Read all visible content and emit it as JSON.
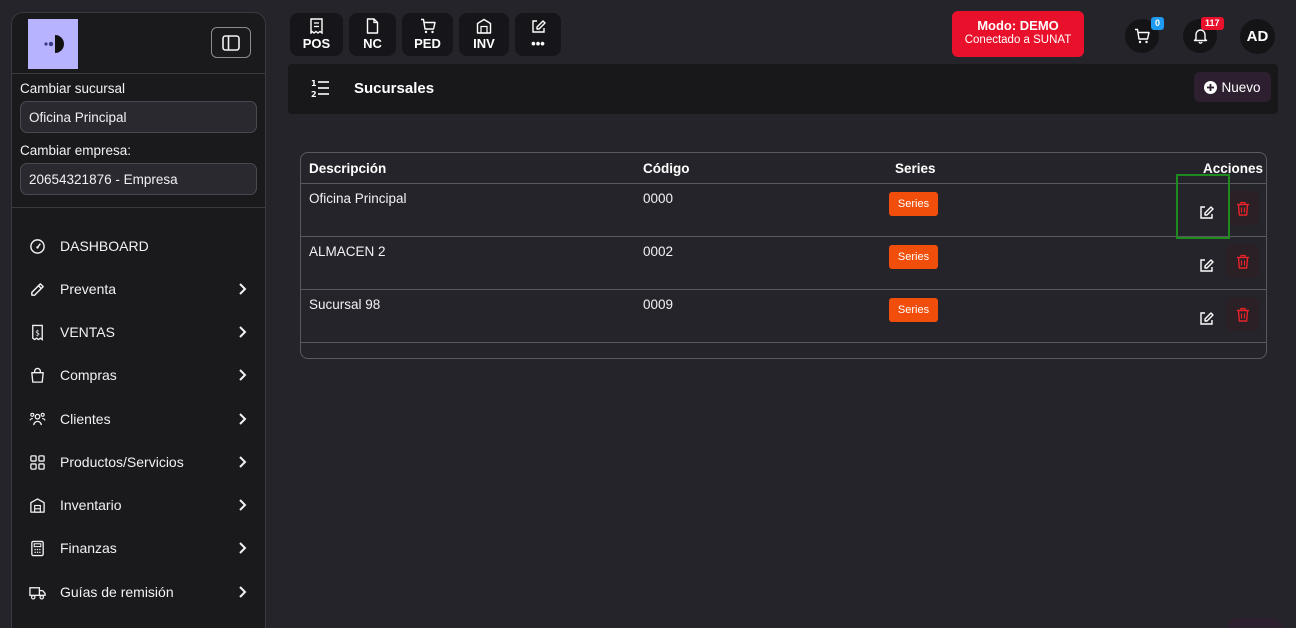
{
  "sidebar": {
    "branch_label": "Cambiar sucursal",
    "branch_value": "Oficina Principal",
    "company_label": "Cambiar empresa:",
    "company_value": "20654321876 - Empresa",
    "items": [
      {
        "label": "DASHBOARD",
        "icon": "gauge-icon"
      },
      {
        "label": "Preventa",
        "icon": "pencil-icon"
      },
      {
        "label": "VENTAS",
        "icon": "receipt-icon"
      },
      {
        "label": "Compras",
        "icon": "shopping-bag-icon"
      },
      {
        "label": "Clientes",
        "icon": "users-icon"
      },
      {
        "label": "Productos/Servicios",
        "icon": "grid-icon"
      },
      {
        "label": "Inventario",
        "icon": "warehouse-icon"
      },
      {
        "label": "Finanzas",
        "icon": "calculator-icon"
      },
      {
        "label": "Guías de remisión",
        "icon": "truck-icon"
      }
    ]
  },
  "topbar": {
    "quick_buttons": [
      {
        "label": "POS",
        "icon": "receipt-icon"
      },
      {
        "label": "NC",
        "icon": "document-icon"
      },
      {
        "label": "PED",
        "icon": "cart-icon"
      },
      {
        "label": "INV",
        "icon": "warehouse-icon"
      },
      {
        "label": "•••",
        "icon": "edit-icon"
      }
    ],
    "mode_title": "Modo: DEMO",
    "mode_subtitle": "Conectado a SUNAT",
    "cart_count": "0",
    "notification_count": "117",
    "avatar_initials": "AD",
    "colors": {
      "mode": "#e8102a",
      "cart_badge": "#1e9bf0",
      "notif_badge": "#e8102a"
    }
  },
  "page": {
    "title": "Sucursales",
    "new_button": "Nuevo"
  },
  "table": {
    "headers": {
      "description": "Descripción",
      "code": "Código",
      "series": "Series",
      "actions": "Acciones"
    },
    "series_button": "Series",
    "rows": [
      {
        "description": "Oficina Principal",
        "code": "0000"
      },
      {
        "description": "ALMACEN 2",
        "code": "0002"
      },
      {
        "description": "Sucursal 98",
        "code": "0009"
      }
    ]
  },
  "colors": {
    "series_button": "#f04e0a",
    "delete_icon": "#e8242a"
  }
}
